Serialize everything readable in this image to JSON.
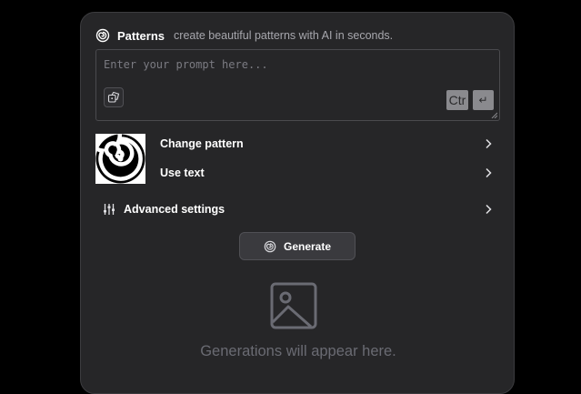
{
  "header": {
    "logo_icon": "spiral-icon",
    "title": "Patterns",
    "tagline": "create beautiful patterns with AI in seconds."
  },
  "prompt": {
    "placeholder": "Enter your prompt here...",
    "value": "",
    "random_icon": "dice-icon",
    "ctrl_key": "Ctr",
    "enter_key": "↵"
  },
  "pattern": {
    "thumbnail_icon": "spiral-pattern",
    "change_label": "Change pattern",
    "use_text_label": "Use text"
  },
  "advanced": {
    "icon": "sliders-icon",
    "label": "Advanced settings"
  },
  "generate": {
    "icon": "spiral-icon",
    "label": "Generate"
  },
  "output": {
    "placeholder_icon": "image-icon",
    "empty_text": "Generations will appear here."
  },
  "colors": {
    "background": "#000000",
    "panel": "#262628",
    "text": "#ffffff",
    "muted": "#a7a7ad",
    "empty": "#6a6b73"
  }
}
